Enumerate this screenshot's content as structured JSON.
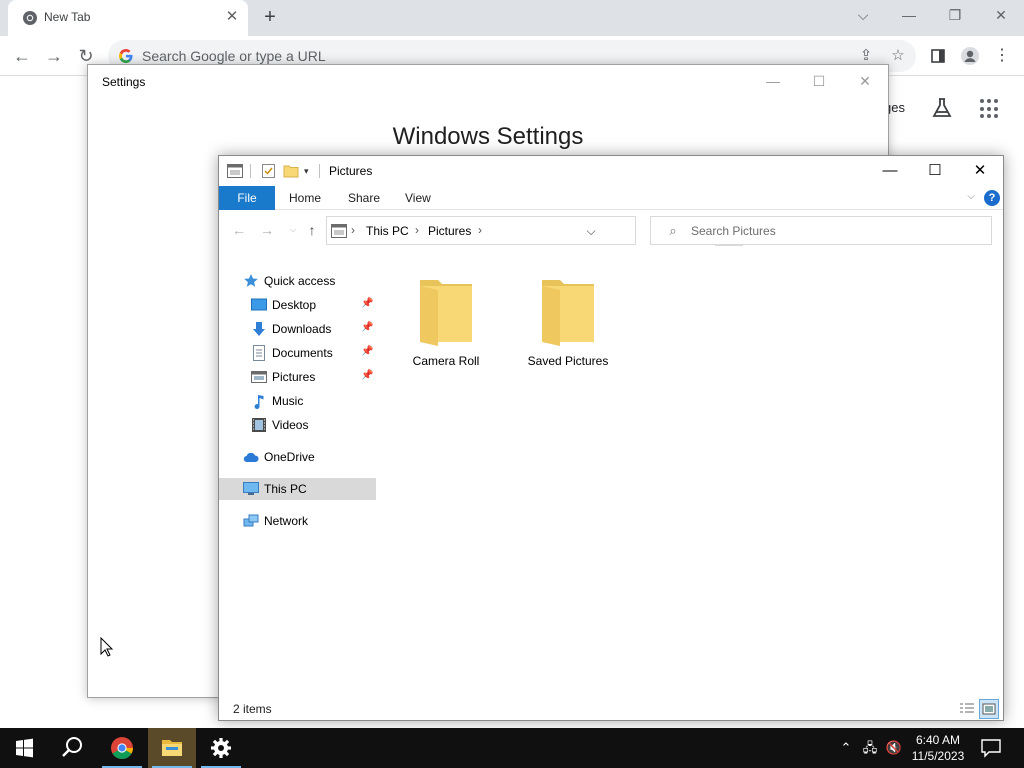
{
  "browser": {
    "tab_title": "New Tab",
    "tab_close": "✕",
    "new_tab": "+",
    "omnibox_placeholder": "Search Google or type a URL",
    "ntp_link_partial": "ges"
  },
  "settings_window": {
    "title": "Settings",
    "heading": "Windows Settings"
  },
  "explorer": {
    "title": "Pictures",
    "ribbon": {
      "file": "File",
      "tabs": [
        "Home",
        "Share",
        "View"
      ],
      "help": "?"
    },
    "breadcrumb": [
      "This PC",
      "Pictures"
    ],
    "search_placeholder": "Search Pictures",
    "nav": {
      "quick_access": "Quick access",
      "pinned": [
        "Desktop",
        "Downloads",
        "Documents",
        "Pictures"
      ],
      "other": [
        "Music",
        "Videos"
      ],
      "onedrive": "OneDrive",
      "this_pc": "This PC",
      "network": "Network"
    },
    "items": [
      "Camera Roll",
      "Saved Pictures"
    ],
    "status": "2 items",
    "selected_nav": "This PC"
  },
  "taskbar": {
    "time": "6:40 AM",
    "date": "11/5/2023",
    "apps": [
      "start",
      "search",
      "chrome",
      "file-explorer",
      "settings"
    ]
  },
  "colors": {
    "accent": "#1979ca",
    "folder": "#f8d775",
    "taskbar": "#101010"
  }
}
